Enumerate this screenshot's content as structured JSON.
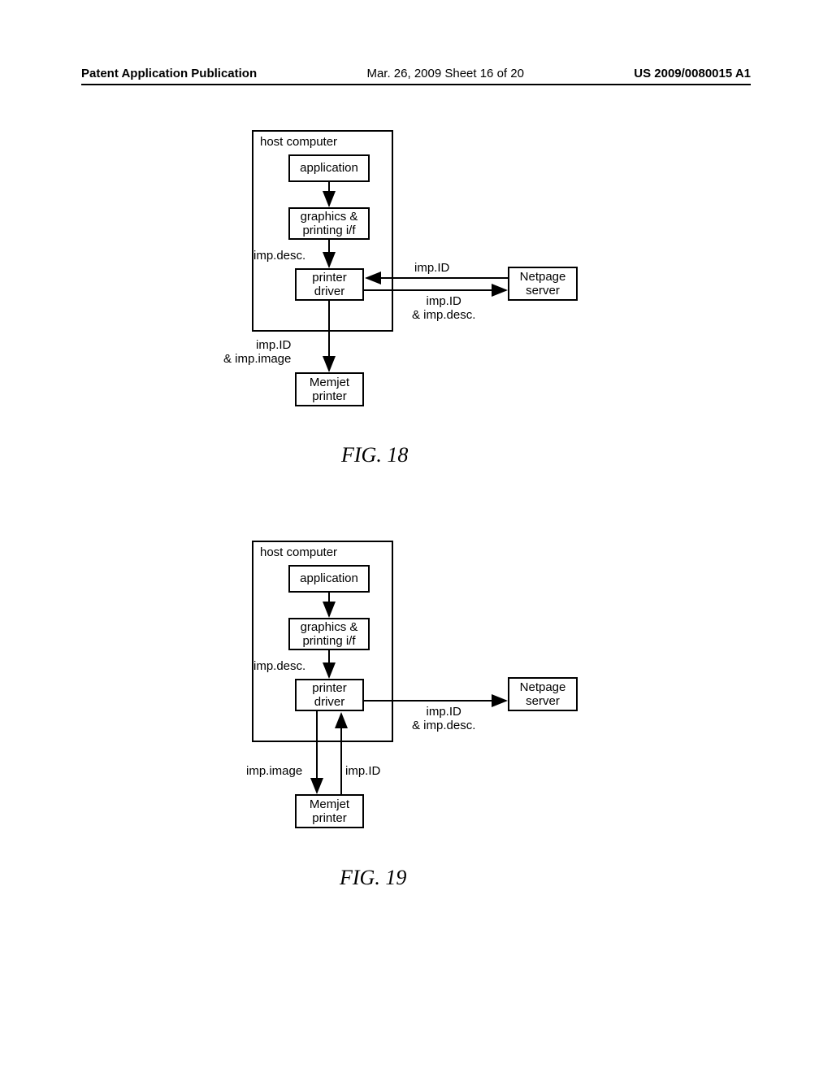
{
  "header": {
    "left": "Patent Application Publication",
    "mid": "Mar. 26, 2009  Sheet 16 of 20",
    "right": "US 2009/0080015 A1"
  },
  "fig18": {
    "caption": "FIG. 18",
    "host": "host computer",
    "application": "application",
    "graphics": "graphics &\nprinting i/f",
    "driver": "printer\ndriver",
    "memjet": "Memjet\nprinter",
    "netpage": "Netpage\nserver",
    "imp_desc": "imp.desc.",
    "imp_id": "imp.ID",
    "imp_id_desc": "imp.ID\n& imp.desc.",
    "imp_id_image": "imp.ID\n& imp.image"
  },
  "fig19": {
    "caption": "FIG. 19",
    "host": "host computer",
    "application": "application",
    "graphics": "graphics &\nprinting i/f",
    "driver": "printer\ndriver",
    "memjet": "Memjet\nprinter",
    "netpage": "Netpage\nserver",
    "imp_desc": "imp.desc.",
    "imp_id_desc": "imp.ID\n& imp.desc.",
    "imp_image": "imp.image",
    "imp_id": "imp.ID"
  }
}
